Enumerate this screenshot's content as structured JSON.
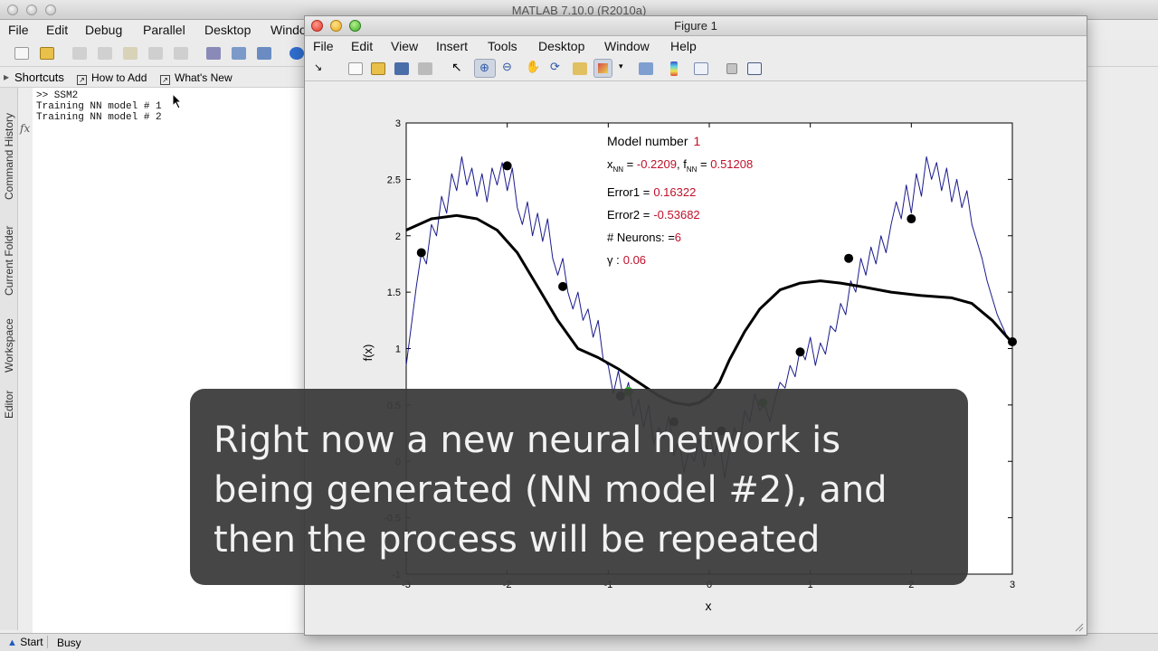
{
  "matlab": {
    "title": "MATLAB  7.10.0 (R2010a)",
    "menu": [
      "File",
      "Edit",
      "Debug",
      "Parallel",
      "Desktop",
      "Windo"
    ],
    "shortcuts": {
      "label": "Shortcuts",
      "how_to_add": "How to Add",
      "whats_new": "What's New"
    },
    "side_tabs": [
      "Command History",
      "Current Folder",
      "Workspace",
      "Editor"
    ],
    "fx": "fx",
    "command_lines": [
      ">> SSM2",
      "Training NN model # 1",
      "Training NN model # 2"
    ],
    "status": {
      "start": "Start",
      "busy": "Busy"
    }
  },
  "figure": {
    "title": "Figure 1",
    "menu": [
      "File",
      "Edit",
      "View",
      "Insert",
      "Tools",
      "Desktop",
      "Window",
      "Help"
    ],
    "annotations": {
      "model_label": "Model number",
      "model_value": "1",
      "x_label": "x",
      "x_sub": "NN",
      "x_value": "-0.2209",
      "f_label": "f",
      "f_sub": "NN",
      "f_value": "0.51208",
      "error1_label": "Error1 =",
      "error1_value": "0.16322",
      "error2_label": "Error2 =",
      "error2_value": "-0.53682",
      "neurons_label": "# Neurons: =",
      "neurons_value": "6",
      "gamma_label": "γ :",
      "gamma_value": "0.06"
    }
  },
  "caption": "Right now a new neural network is being generated (NN model #2), and then the process will be repeated",
  "chart_data": {
    "type": "line",
    "xlabel": "x",
    "ylabel": "f(x)",
    "xlim": [
      -3,
      3
    ],
    "ylim": [
      -1,
      3
    ],
    "xticks": [
      -3,
      -2,
      -1,
      0,
      1,
      2,
      3
    ],
    "xtick_labels": [
      "-3",
      "-2",
      "-1",
      "0",
      "1",
      "2",
      "3"
    ],
    "yticks": [
      -1,
      -0.5,
      0,
      0.5,
      1,
      1.5,
      2,
      2.5,
      3
    ],
    "ytick_labels": [
      "-1",
      "-0.5",
      "0",
      "0.5",
      "1",
      "1.5",
      "2",
      "2.5",
      "3"
    ],
    "series": [
      {
        "style": "thin-blue",
        "color": "#1a1a8c",
        "x": [
          -3,
          -2.9,
          -2.85,
          -2.8,
          -2.75,
          -2.7,
          -2.65,
          -2.6,
          -2.55,
          -2.5,
          -2.45,
          -2.4,
          -2.35,
          -2.3,
          -2.25,
          -2.2,
          -2.15,
          -2.1,
          -2.05,
          -2,
          -1.95,
          -1.9,
          -1.85,
          -1.8,
          -1.75,
          -1.7,
          -1.65,
          -1.6,
          -1.55,
          -1.5,
          -1.45,
          -1.4,
          -1.35,
          -1.3,
          -1.25,
          -1.2,
          -1.15,
          -1.1,
          -1.05,
          -1,
          -0.95,
          -0.9,
          -0.85,
          -0.8,
          -0.75,
          -0.7,
          -0.65,
          -0.6,
          -0.55,
          -0.5,
          -0.45,
          -0.4,
          -0.35,
          -0.3,
          -0.25,
          -0.2,
          -0.15,
          -0.1,
          -0.05,
          0,
          0.05,
          0.1,
          0.15,
          0.2,
          0.25,
          0.3,
          0.35,
          0.4,
          0.45,
          0.5,
          0.55,
          0.6,
          0.65,
          0.7,
          0.75,
          0.8,
          0.85,
          0.9,
          0.95,
          1,
          1.05,
          1.1,
          1.15,
          1.2,
          1.25,
          1.3,
          1.35,
          1.4,
          1.45,
          1.5,
          1.55,
          1.6,
          1.65,
          1.7,
          1.75,
          1.8,
          1.85,
          1.9,
          1.95,
          2,
          2.05,
          2.1,
          2.15,
          2.2,
          2.25,
          2.3,
          2.35,
          2.4,
          2.45,
          2.5,
          2.55,
          2.6,
          2.65,
          2.7,
          2.75,
          2.8,
          2.85,
          2.9,
          2.95,
          3
        ],
        "y": [
          0.85,
          1.55,
          1.85,
          1.75,
          2.1,
          2.0,
          2.35,
          2.2,
          2.55,
          2.4,
          2.7,
          2.45,
          2.6,
          2.35,
          2.55,
          2.3,
          2.6,
          2.45,
          2.65,
          2.4,
          2.6,
          2.25,
          2.1,
          2.3,
          2.0,
          2.2,
          1.95,
          2.15,
          1.8,
          1.65,
          1.8,
          1.5,
          1.35,
          1.5,
          1.25,
          1.35,
          1.1,
          1.25,
          0.9,
          0.85,
          0.6,
          0.8,
          0.55,
          0.7,
          0.4,
          0.55,
          0.3,
          0.5,
          0.15,
          0.3,
          0.2,
          0.4,
          0.05,
          0.2,
          -0.1,
          0.1,
          0.0,
          0.2,
          -0.05,
          0.25,
          0.05,
          0.2,
          -0.15,
          0.1,
          0.3,
          0.15,
          0.45,
          0.35,
          0.6,
          0.45,
          0.5,
          0.35,
          0.55,
          0.7,
          0.65,
          0.85,
          0.75,
          1.0,
          0.9,
          1.1,
          0.85,
          1.05,
          0.95,
          1.2,
          1.15,
          1.4,
          1.3,
          1.6,
          1.5,
          1.8,
          1.65,
          1.9,
          1.75,
          2.0,
          1.85,
          2.1,
          2.3,
          2.15,
          2.45,
          2.2,
          2.55,
          2.35,
          2.7,
          2.5,
          2.65,
          2.4,
          2.6,
          2.3,
          2.5,
          2.25,
          2.4,
          2.1,
          1.95,
          1.8,
          1.6,
          1.45,
          1.3,
          1.2,
          1.1,
          1.05
        ]
      },
      {
        "style": "thick-black",
        "color": "#000000",
        "x": [
          -3,
          -2.75,
          -2.5,
          -2.3,
          -2.1,
          -1.9,
          -1.7,
          -1.5,
          -1.3,
          -1.1,
          -0.9,
          -0.7,
          -0.5,
          -0.35,
          -0.2,
          -0.1,
          0,
          0.1,
          0.2,
          0.35,
          0.5,
          0.7,
          0.9,
          1.1,
          1.3,
          1.5,
          1.8,
          2.1,
          2.4,
          2.6,
          2.8,
          3
        ],
        "y": [
          2.05,
          2.15,
          2.18,
          2.15,
          2.05,
          1.85,
          1.55,
          1.25,
          1.0,
          0.92,
          0.82,
          0.7,
          0.58,
          0.52,
          0.5,
          0.52,
          0.58,
          0.7,
          0.9,
          1.15,
          1.35,
          1.52,
          1.58,
          1.6,
          1.58,
          1.55,
          1.5,
          1.47,
          1.45,
          1.4,
          1.25,
          1.05
        ]
      }
    ],
    "points_black": {
      "x": [
        -2.85,
        -2,
        -1.45,
        -0.35,
        0.12,
        0.9,
        1.38,
        2.0,
        3
      ],
      "y": [
        1.85,
        2.62,
        1.55,
        0.35,
        0.27,
        0.97,
        1.8,
        2.15,
        1.06
      ]
    },
    "points_green": {
      "color": "#22aa22",
      "x": [
        -0.8,
        0.53
      ],
      "y": [
        0.62,
        0.52
      ]
    },
    "points_navy": {
      "color": "#101040",
      "x": [
        -0.88
      ],
      "y": [
        0.58
      ]
    }
  }
}
